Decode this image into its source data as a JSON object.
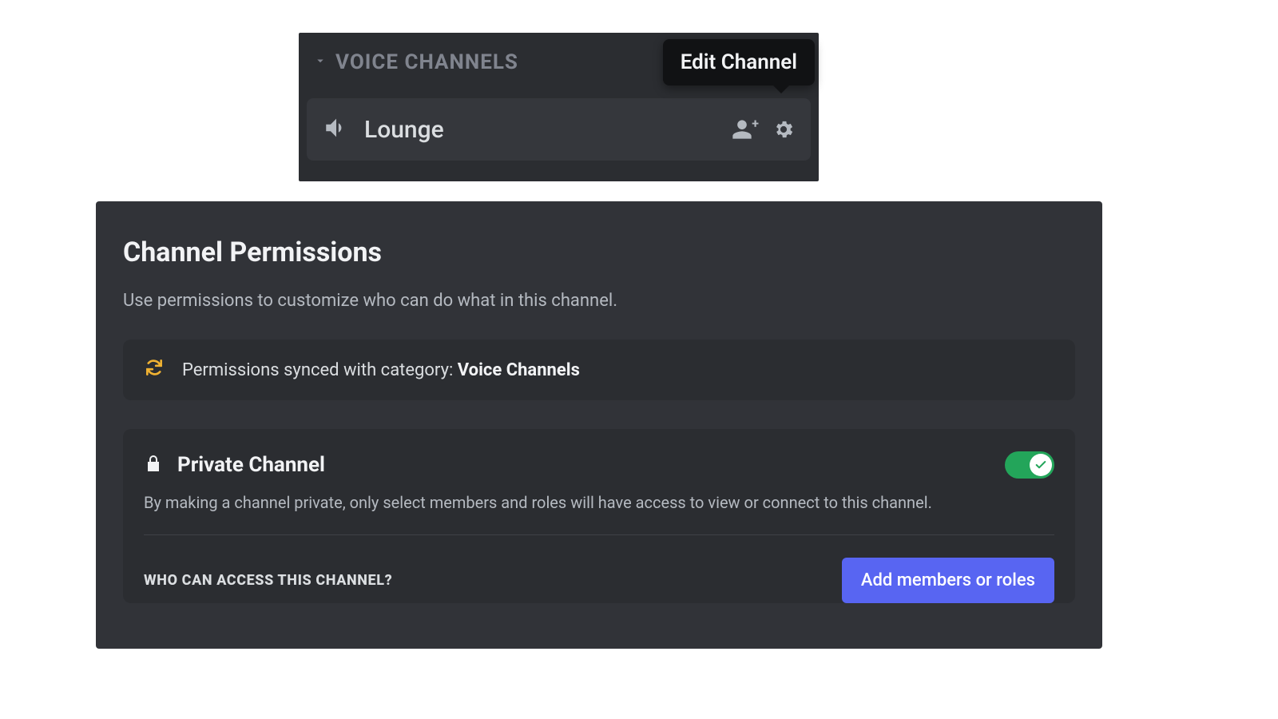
{
  "channel_list": {
    "category_label": "VOICE CHANNELS",
    "channel_name": "Lounge",
    "tooltip": "Edit Channel"
  },
  "permissions": {
    "title": "Channel Permissions",
    "description": "Use permissions to customize who can do what in this channel.",
    "sync_text_prefix": "Permissions synced with category: ",
    "sync_category": "Voice Channels",
    "private": {
      "title": "Private Channel",
      "description": "By making a channel private, only select members and roles will have access to view or connect to this channel.",
      "enabled": true
    },
    "access_label": "WHO CAN ACCESS THIS CHANNEL?",
    "add_button": "Add members or roles"
  }
}
